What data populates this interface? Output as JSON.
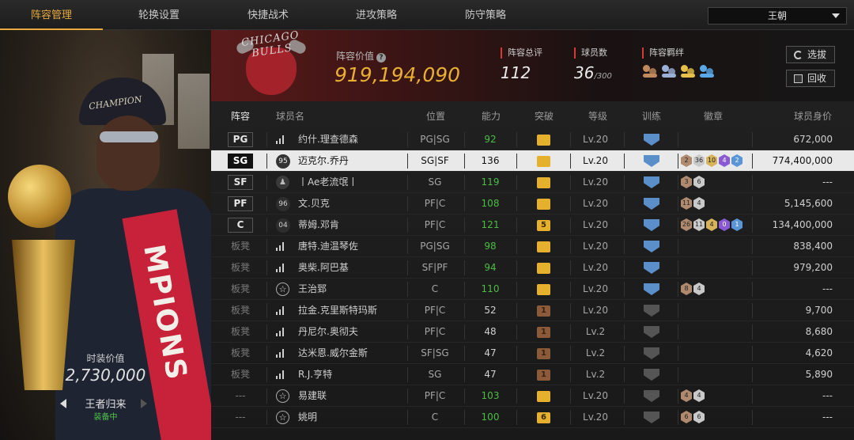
{
  "tabs": [
    {
      "label": "阵容管理",
      "active": true
    },
    {
      "label": "轮换设置",
      "active": false
    },
    {
      "label": "快捷战术",
      "active": false
    },
    {
      "label": "进攻策略",
      "active": false
    },
    {
      "label": "防守策略",
      "active": false
    }
  ],
  "team_select": {
    "value": "王朝"
  },
  "player_card": {
    "cap_text": "CHAMPION",
    "sash_text": "MPIONS",
    "value_label": "时装价值",
    "value": "2,730,000",
    "card_name": "王者归来",
    "status": "装备中"
  },
  "header": {
    "logo_text": "CHICAGO BULLS",
    "lineup_value_label": "阵容价值",
    "lineup_value": "919,194,090",
    "rating_label": "阵容总评",
    "rating": "112",
    "count_label": "球员数",
    "count": "36",
    "count_max": "/300",
    "bond_label": "阵容羁绊",
    "bonds": [
      {
        "icon": "bond-bronze-icon",
        "color": "#c28a5c"
      },
      {
        "icon": "bond-silver-icon",
        "color": "#9ab0d6"
      },
      {
        "icon": "bond-gold-icon",
        "color": "#e6c04a"
      },
      {
        "icon": "bond-blue-icon",
        "color": "#5aa8e8"
      }
    ],
    "btn_select": "选拔",
    "btn_recycle": "回收"
  },
  "table": {
    "columns": [
      "阵容",
      "球员名",
      "位置",
      "能力",
      "突破",
      "等级",
      "训练",
      "徽章",
      "球员身价"
    ],
    "rows": [
      {
        "slot": "PG",
        "starter": true,
        "icon": "bars",
        "name": "约什.理查德森",
        "position": "PG|SG",
        "ability": "92",
        "ability_green": true,
        "break": "",
        "break_type": "gold",
        "level": "Lv.20",
        "train": "blue",
        "badges": [],
        "value": "672,000",
        "selected": false
      },
      {
        "slot": "SG",
        "starter": true,
        "icon": "num",
        "num": "95",
        "name": "迈克尔.乔丹",
        "position": "SG|SF",
        "ability": "136",
        "ability_green": false,
        "break": "",
        "break_type": "gold",
        "level": "Lv.20",
        "train": "blue",
        "badges": [
          {
            "t": "b-bronze",
            "v": "2"
          },
          {
            "t": "b-silver",
            "v": "36"
          },
          {
            "t": "b-gold",
            "v": "10"
          },
          {
            "t": "b-purple",
            "v": "4"
          },
          {
            "t": "b-blue",
            "v": "2"
          }
        ],
        "value": "774,400,000",
        "selected": true
      },
      {
        "slot": "SF",
        "starter": true,
        "icon": "person",
        "name": "丨Ae老流氓丨",
        "position": "SG",
        "ability": "119",
        "ability_green": true,
        "break": "",
        "break_type": "gold",
        "level": "Lv.20",
        "train": "blue",
        "badges": [
          {
            "t": "b-bronze",
            "v": "3"
          },
          {
            "t": "b-silver",
            "v": "6"
          }
        ],
        "value": "---",
        "selected": false
      },
      {
        "slot": "PF",
        "starter": true,
        "icon": "num",
        "num": "96",
        "name": "文.贝克",
        "position": "PF|C",
        "ability": "108",
        "ability_green": true,
        "break": "",
        "break_type": "gold",
        "level": "Lv.20",
        "train": "blue",
        "badges": [
          {
            "t": "b-bronze",
            "v": "11"
          },
          {
            "t": "b-silver",
            "v": "4"
          }
        ],
        "value": "5,145,600",
        "selected": false
      },
      {
        "slot": "C",
        "starter": true,
        "icon": "num",
        "num": "04",
        "name": "蒂姆.邓肯",
        "position": "PF|C",
        "ability": "121",
        "ability_green": true,
        "break": "5",
        "break_type": "gold",
        "level": "Lv.20",
        "train": "blue",
        "badges": [
          {
            "t": "b-bronze",
            "v": "26"
          },
          {
            "t": "b-silver",
            "v": "11"
          },
          {
            "t": "b-gold",
            "v": "4"
          },
          {
            "t": "b-purple",
            "v": "0"
          },
          {
            "t": "b-blue",
            "v": "1"
          }
        ],
        "value": "134,400,000",
        "selected": false
      },
      {
        "slot": "板凳",
        "starter": false,
        "icon": "bars",
        "name": "唐特.迪温琴佐",
        "position": "PG|SG",
        "ability": "98",
        "ability_green": true,
        "break": "",
        "break_type": "gold",
        "level": "Lv.20",
        "train": "blue",
        "badges": [],
        "value": "838,400",
        "selected": false
      },
      {
        "slot": "板凳",
        "starter": false,
        "icon": "bars",
        "name": "奥柴.阿巴基",
        "position": "SF|PF",
        "ability": "94",
        "ability_green": true,
        "break": "",
        "break_type": "gold",
        "level": "Lv.20",
        "train": "blue",
        "badges": [],
        "value": "979,200",
        "selected": false
      },
      {
        "slot": "板凳",
        "starter": false,
        "icon": "star",
        "name": "王治郅",
        "position": "C",
        "ability": "110",
        "ability_green": true,
        "break": "",
        "break_type": "gold",
        "level": "Lv.20",
        "train": "blue",
        "badges": [
          {
            "t": "b-bronze",
            "v": "8"
          },
          {
            "t": "b-silver",
            "v": "4"
          }
        ],
        "value": "---",
        "selected": false
      },
      {
        "slot": "板凳",
        "starter": false,
        "icon": "bars",
        "name": "拉金.克里斯特玛斯",
        "position": "PF|C",
        "ability": "52",
        "ability_green": false,
        "break": "1",
        "break_type": "brown",
        "level": "Lv.20",
        "train": "gray",
        "badges": [],
        "value": "9,700",
        "selected": false
      },
      {
        "slot": "板凳",
        "starter": false,
        "icon": "bars",
        "name": "丹尼尔.奥彻夫",
        "position": "PF|C",
        "ability": "48",
        "ability_green": false,
        "break": "1",
        "break_type": "brown",
        "level": "Lv.2",
        "train": "gray",
        "badges": [],
        "value": "8,680",
        "selected": false
      },
      {
        "slot": "板凳",
        "starter": false,
        "icon": "bars",
        "name": "达米恩.威尔金斯",
        "position": "SF|SG",
        "ability": "47",
        "ability_green": false,
        "break": "1",
        "break_type": "brown",
        "level": "Lv.2",
        "train": "gray",
        "badges": [],
        "value": "4,620",
        "selected": false
      },
      {
        "slot": "板凳",
        "starter": false,
        "icon": "bars",
        "name": "R.J.亨特",
        "position": "SG",
        "ability": "47",
        "ability_green": false,
        "break": "1",
        "break_type": "brown",
        "level": "Lv.2",
        "train": "gray",
        "badges": [],
        "value": "5,890",
        "selected": false
      },
      {
        "slot": "---",
        "starter": false,
        "icon": "star",
        "name": "易建联",
        "position": "PF|C",
        "ability": "103",
        "ability_green": true,
        "break": "",
        "break_type": "gold",
        "level": "Lv.20",
        "train": "gray",
        "badges": [
          {
            "t": "b-bronze",
            "v": "4"
          },
          {
            "t": "b-silver",
            "v": "4"
          }
        ],
        "value": "---",
        "selected": false
      },
      {
        "slot": "---",
        "starter": false,
        "icon": "star",
        "name": "姚明",
        "position": "C",
        "ability": "100",
        "ability_green": true,
        "break": "6",
        "break_type": "gold",
        "level": "Lv.20",
        "train": "gray",
        "badges": [
          {
            "t": "b-bronze",
            "v": "6"
          },
          {
            "t": "b-silver",
            "v": "6"
          }
        ],
        "value": "---",
        "selected": false
      }
    ]
  }
}
